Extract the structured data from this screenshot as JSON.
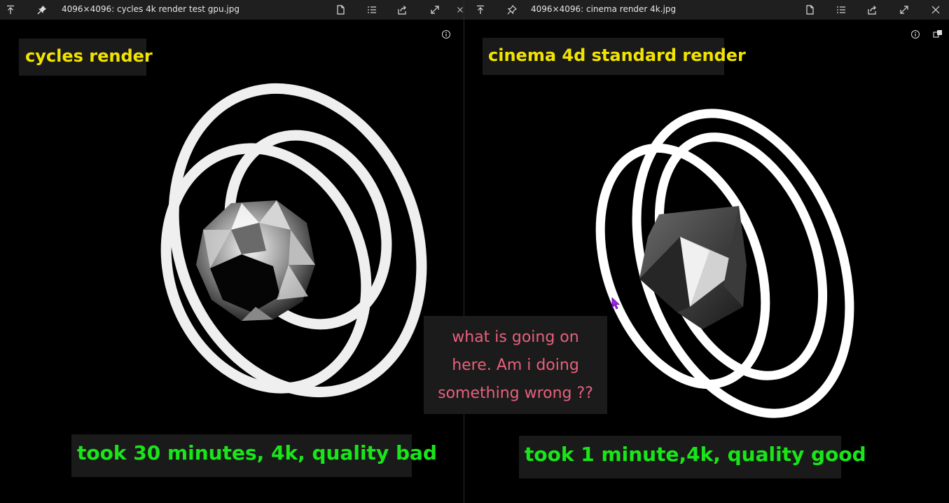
{
  "left_viewer": {
    "title": "4096×4096: cycles 4k render test gpu.jpg",
    "caption_title": "cycles render",
    "caption_bottom": "took 30 minutes, 4k, quality bad",
    "icons": [
      "pin-top-icon",
      "pin-icon",
      "open-file-icon",
      "list-icon",
      "share-icon",
      "fullscreen-icon",
      "close-icon",
      "info-icon"
    ]
  },
  "right_viewer": {
    "title": "4096×4096: cinema render 4k.jpg",
    "caption_title": "cinema 4d standard render",
    "caption_bottom": "took 1 minute,4k, quality good",
    "icons": [
      "pin-top-icon",
      "pin-icon",
      "open-file-icon",
      "list-icon",
      "share-icon",
      "fullscreen-icon",
      "close-icon",
      "info-icon",
      "compare-icon"
    ]
  },
  "question": {
    "line1": "what is going on",
    "line2": "here. Am i doing",
    "line3": "something wrong ??"
  },
  "colors": {
    "caption_title": "#f2e400",
    "caption_bottom": "#19e619",
    "question_text": "#e8607c",
    "titlebar_bg": "#1f1f1f",
    "cursor": "#a020f0"
  }
}
